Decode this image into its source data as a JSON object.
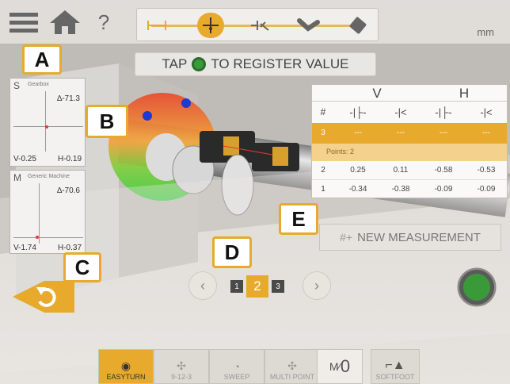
{
  "app": {
    "unit": "mm"
  },
  "banner": {
    "pre": "TAP",
    "post": "TO REGISTER VALUE"
  },
  "callouts": {
    "a": "A",
    "b": "B",
    "c": "C",
    "d": "D",
    "e": "E"
  },
  "card_s": {
    "letter": "S",
    "label": "Gearbox",
    "angle": "∆-71.3",
    "v": "V-0.25",
    "h": "H-0.19"
  },
  "card_m": {
    "letter": "M",
    "label": "Generic Machine",
    "angle": "∆-70.6",
    "v": "V-1.74",
    "h": "H-0.37"
  },
  "table": {
    "group_v": "V",
    "group_h": "H",
    "hash": "#",
    "active_row": {
      "num": "3",
      "v1": "---",
      "v2": "---",
      "h1": "---",
      "h2": "---"
    },
    "points_label": "Points: 2",
    "rows": [
      {
        "num": "2",
        "v1": "0.25",
        "v2": "0.11",
        "h1": "-0.58",
        "h2": "-0.53"
      },
      {
        "num": "1",
        "v1": "-0.34",
        "v2": "-0.38",
        "h1": "-0.09",
        "h2": "-0.09"
      }
    ]
  },
  "new_measurement": "NEW MEASUREMENT",
  "pager": {
    "pages": [
      "1",
      "2",
      "3"
    ],
    "current": "2",
    "prev": "‹",
    "next": "›"
  },
  "modes": [
    "EASYTURN",
    "9-12-3",
    "SWEEP",
    "MULTI POINT"
  ],
  "counter": {
    "value": "0"
  },
  "softfoot": "SOFTFOOT",
  "help": "?",
  "colors": {
    "accent": "#e7aa2c",
    "green": "#3a9a3a"
  }
}
